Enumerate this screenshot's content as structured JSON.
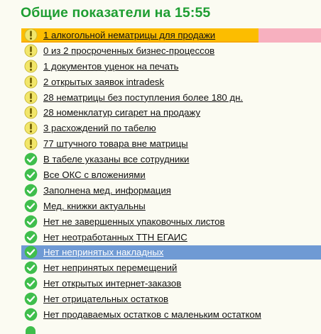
{
  "header": {
    "title": "Общие показатели на 15:55"
  },
  "items": [
    {
      "label": "1 алкогольной нематрицы для продажи",
      "status": "warning",
      "icon": "exclamation-icon",
      "state": "flagged"
    },
    {
      "label": "0 из 2 просроченных бизнес-процессов",
      "status": "warning",
      "icon": "exclamation-icon",
      "state": "normal"
    },
    {
      "label": "1 документов уценок на печать",
      "status": "warning",
      "icon": "exclamation-icon",
      "state": "normal"
    },
    {
      "label": "2 открытых заявок intradesk",
      "status": "warning",
      "icon": "exclamation-icon",
      "state": "normal"
    },
    {
      "label": "28 нематрицы без поступления более 180 дн.",
      "status": "warning",
      "icon": "exclamation-icon",
      "state": "normal"
    },
    {
      "label": "28 номенклатур сигарет на продажу",
      "status": "warning",
      "icon": "exclamation-icon",
      "state": "normal"
    },
    {
      "label": "3 расхождений по табелю",
      "status": "warning",
      "icon": "exclamation-icon",
      "state": "normal"
    },
    {
      "label": "77 штучного товара вне матрицы",
      "status": "warning",
      "icon": "exclamation-icon",
      "state": "normal"
    },
    {
      "label": "В табеле указаны все сотрудники",
      "status": "ok",
      "icon": "check-icon",
      "state": "normal"
    },
    {
      "label": "Все ОКС с вложениями",
      "status": "ok",
      "icon": "check-icon",
      "state": "normal"
    },
    {
      "label": "Заполнена мед. информация",
      "status": "ok",
      "icon": "check-icon",
      "state": "normal"
    },
    {
      "label": "Мед. книжки актуальны",
      "status": "ok",
      "icon": "check-icon",
      "state": "normal"
    },
    {
      "label": "Нет не завершенных упаковочных листов",
      "status": "ok",
      "icon": "check-icon",
      "state": "normal"
    },
    {
      "label": "Нет неотработанных ТТН ЕГАИС",
      "status": "ok",
      "icon": "check-icon",
      "state": "normal"
    },
    {
      "label": "Нет непринятых накладных",
      "status": "ok",
      "icon": "check-icon",
      "state": "selected"
    },
    {
      "label": "Нет непринятых перемещений",
      "status": "ok",
      "icon": "check-icon",
      "state": "normal"
    },
    {
      "label": "Нет открытых интернет-заказов",
      "status": "ok",
      "icon": "check-icon",
      "state": "normal"
    },
    {
      "label": "Нет отрицательных остатков",
      "status": "ok",
      "icon": "check-icon",
      "state": "normal"
    },
    {
      "label": "Нет продаваемых остатков с маленьким остатком",
      "status": "ok",
      "icon": "check-icon",
      "state": "normal"
    }
  ],
  "colors": {
    "title": "#1e9e32",
    "warning_fill": "#f2e66a",
    "ok_fill": "#3fbe4c",
    "flag_row": "#f7b0bf",
    "flag_marker": "#fcbd00",
    "selected_row": "#6f9ad4"
  }
}
